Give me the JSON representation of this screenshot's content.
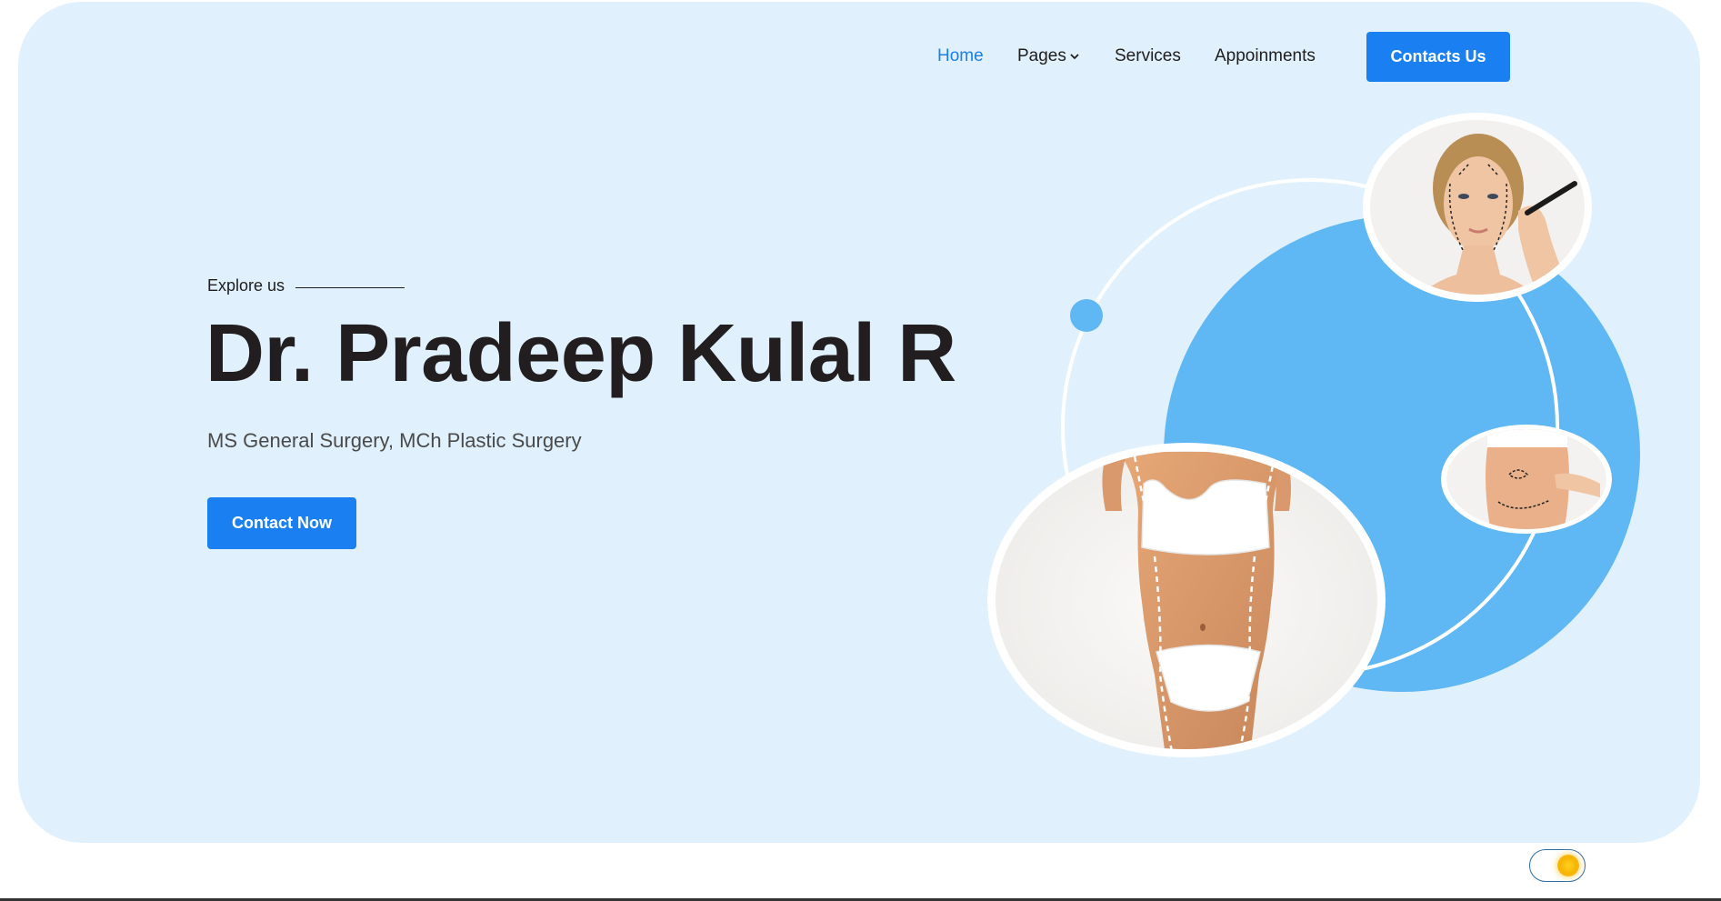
{
  "nav": {
    "items": [
      {
        "label": "Home",
        "active": true
      },
      {
        "label": "Pages",
        "has_dropdown": true
      },
      {
        "label": "Services"
      },
      {
        "label": "Appoinments"
      }
    ],
    "cta_label": "Contacts Us"
  },
  "hero": {
    "eyebrow": "Explore us",
    "title": "Dr. Pradeep Kulal R",
    "subtitle": "MS General Surgery, MCh Plastic Surgery",
    "cta_label": "Contact Now"
  },
  "images": {
    "face": "face-surgery-markings-photo",
    "abdomen": "abdomen-surgery-markings-photo",
    "body": "body-contouring-markings-photo"
  },
  "theme_toggle": {
    "icon": "sun-icon",
    "mode": "light"
  },
  "colors": {
    "hero_bg": "#e0f1fd",
    "accent": "#1a7ff1",
    "accent_circle": "#5fb7f4",
    "active_link": "#1a7fe6",
    "heading": "#221d1e"
  }
}
